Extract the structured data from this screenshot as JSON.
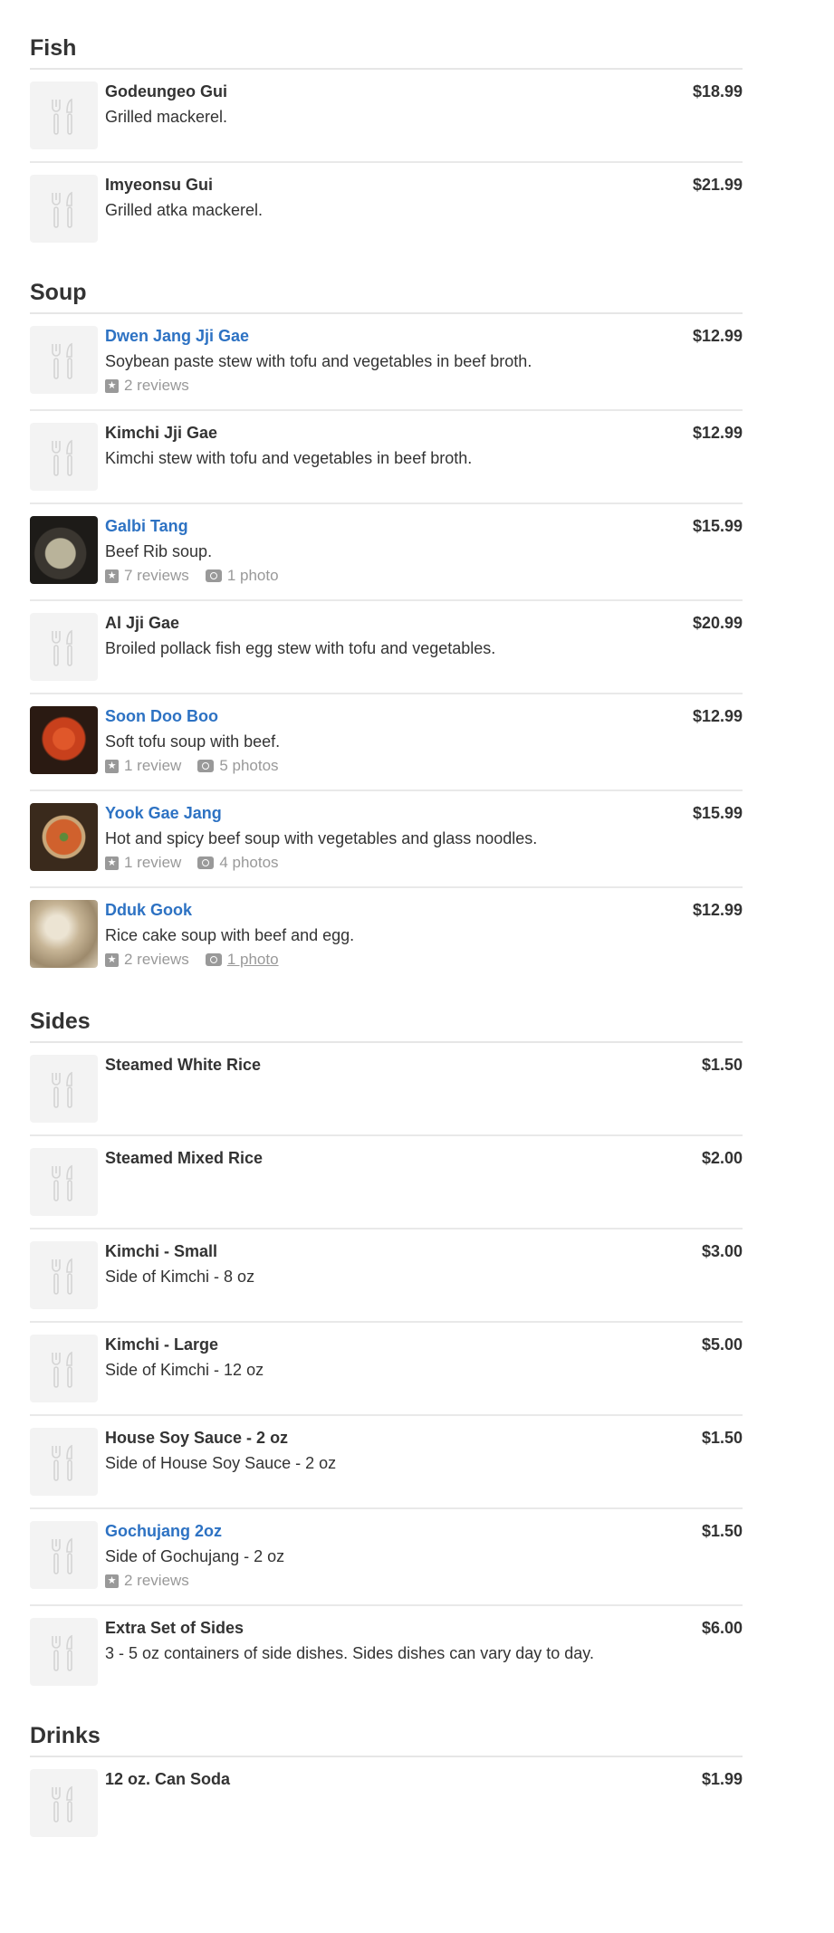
{
  "sections": [
    {
      "title": "Fish",
      "items": [
        {
          "name": "Godeungeo Gui",
          "desc": "Grilled mackerel.",
          "price": "$18.99",
          "link": false
        },
        {
          "name": "Imyeonsu Gui",
          "desc": "Grilled atka mackerel.",
          "price": "$21.99",
          "link": false
        }
      ]
    },
    {
      "title": "Soup",
      "items": [
        {
          "name": "Dwen Jang Jji Gae",
          "desc": "Soybean paste stew with tofu and vegetables in beef broth.",
          "price": "$12.99",
          "link": true,
          "reviews": "2 reviews"
        },
        {
          "name": "Kimchi Jji Gae",
          "desc": "Kimchi stew with tofu and vegetables in beef broth.",
          "price": "$12.99",
          "link": false
        },
        {
          "name": "Galbi Tang",
          "desc": "Beef Rib soup.",
          "price": "$15.99",
          "link": true,
          "reviews": "7 reviews",
          "photos": "1 photo",
          "photo": "galbi"
        },
        {
          "name": "Al Jji Gae",
          "desc": "Broiled pollack fish egg stew with tofu and vegetables.",
          "price": "$20.99",
          "link": false
        },
        {
          "name": "Soon Doo Boo",
          "desc": "Soft tofu soup with beef.",
          "price": "$12.99",
          "link": true,
          "reviews": "1 review",
          "photos": "5 photos",
          "photo": "soon"
        },
        {
          "name": "Yook Gae Jang",
          "desc": "Hot and spicy beef soup with vegetables and glass noodles.",
          "price": "$15.99",
          "link": true,
          "reviews": "1 review",
          "photos": "4 photos",
          "photo": "yook"
        },
        {
          "name": "Dduk Gook",
          "desc": "Rice cake soup with beef and egg.",
          "price": "$12.99",
          "link": true,
          "reviews": "2 reviews",
          "photos": "1 photo",
          "photo": "dduk",
          "photos_hovered": true
        }
      ]
    },
    {
      "title": "Sides",
      "items": [
        {
          "name": "Steamed White Rice",
          "price": "$1.50",
          "link": false
        },
        {
          "name": "Steamed Mixed Rice",
          "price": "$2.00",
          "link": false
        },
        {
          "name": "Kimchi - Small",
          "desc": "Side of Kimchi - 8 oz",
          "price": "$3.00",
          "link": false
        },
        {
          "name": "Kimchi - Large",
          "desc": "Side of Kimchi - 12 oz",
          "price": "$5.00",
          "link": false
        },
        {
          "name": "House Soy Sauce - 2 oz",
          "desc": "Side of House Soy Sauce - 2 oz",
          "price": "$1.50",
          "link": false
        },
        {
          "name": "Gochujang 2oz",
          "desc": "Side of Gochujang - 2 oz",
          "price": "$1.50",
          "link": true,
          "reviews": "2 reviews"
        },
        {
          "name": "Extra Set of Sides",
          "desc": "3 - 5 oz containers of side dishes. Sides dishes can vary day to day.",
          "price": "$6.00",
          "link": false
        }
      ]
    },
    {
      "title": "Drinks",
      "items": [
        {
          "name": "12 oz. Can Soda",
          "price": "$1.99",
          "link": false
        }
      ]
    }
  ],
  "colors": {
    "link": "#2d72c3",
    "text": "#333333",
    "meta": "#999999",
    "divider": "#e9e9e9"
  }
}
